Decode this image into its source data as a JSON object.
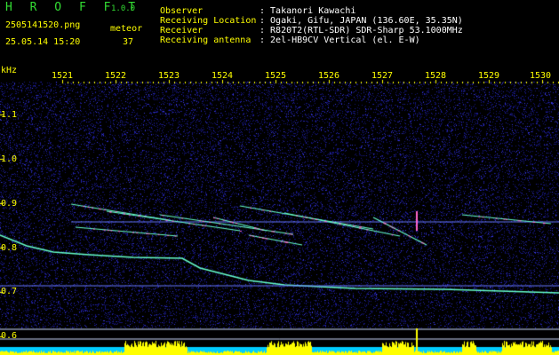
{
  "app": {
    "name": "H R O F F T",
    "version": "1.0.0"
  },
  "file": {
    "name": "2505141520.png",
    "datetime": "25.05.14 15:20",
    "meteor_label": "meteor",
    "meteor_count": "37"
  },
  "info": {
    "observer_label": "Observer",
    "observer_value": ": Takanori Kawachi",
    "location_label": "Receiving Location",
    "location_value": ": Ogaki, Gifu, JAPAN (136.60E, 35.35N)",
    "receiver_label": "Receiver",
    "receiver_value": ": R820T2(RTL-SDR) SDR-Sharp 53.1000MHz",
    "antenna_label": "Receiving antenna",
    "antenna_value": ": 2el-HB9CV Vertical (el. E-W)"
  },
  "axes": {
    "y_unit": "kHz",
    "x_ticks": [
      "1521",
      "1522",
      "1523",
      "1524",
      "1525",
      "1526",
      "1527",
      "1528",
      "1529",
      "1530"
    ],
    "y_ticks": [
      "1.1",
      "1.0",
      "0.9",
      "0.8",
      "0.7",
      "0.6"
    ]
  },
  "colors": {
    "background": "#000000",
    "noise": "#1a1a8c",
    "trace": "#66ffcc",
    "echo": "#ff66cc",
    "baseline_fill": "#00ccff",
    "level_fill": "#ffff00",
    "label": "#ffff00"
  }
}
